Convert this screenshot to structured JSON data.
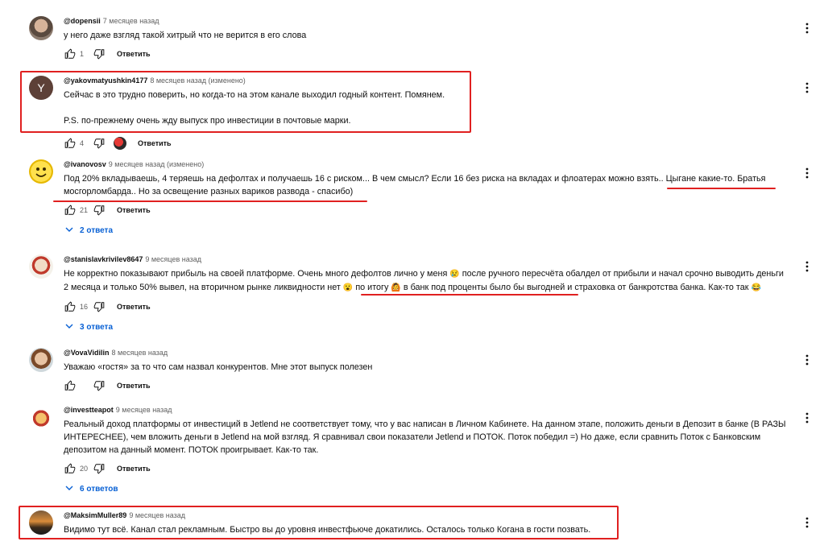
{
  "comments": [
    {
      "author": "@dopensii",
      "time": "7 месяцев назад",
      "text": [
        "у него даже взгляд такой хитрый что не верится в его слова"
      ],
      "likes": "1",
      "reply_label": "Ответить",
      "avatar": "photo"
    },
    {
      "author": "@yakovmatyushkin4177",
      "time": "8 месяцев назад (изменено)",
      "text": [
        "Сейчас в это трудно поверить, но когда-то на этом канале выходил годный контент. Помянем.",
        "P.S. по-прежнему очень жду выпуск про инвестиции в почтовые марки."
      ],
      "likes": "4",
      "reply_label": "Ответить",
      "avatar_letter": "Y"
    },
    {
      "author": "@ivanovosv",
      "time": "9 месяцев назад (изменено)",
      "text_line1": "Под 20% вкладываешь, 4 теряешь на дефолтах и получаешь 16 с риском... В чем смысл? Если 16 без риска на вкладах и флоатерах можно взять.. Цыгане какие-то. Братья",
      "text_line2": "мосгорломбарда.. Но за освещение разных вариков развода - спасибо)",
      "likes": "21",
      "reply_label": "Ответить",
      "replies": "2 ответа"
    },
    {
      "author": "@stanislavkrivilev8647",
      "time": "9 месяцев назад",
      "text_line1": "Не корректно показывают прибыль на своей платформе. Очень много дефолтов лично у меня",
      "text_line1b": "после ручного пересчёта обалдел от прибыли и начал срочно выводить деньги",
      "text_line2a": "2 месяца и только 50% вывел, на вторичном рынке ликвидности нет",
      "text_line2b": "по итогу",
      "text_line2c": "в банк под проценты было бы выгодней",
      "text_line2d": "и страховка от банкротства банка. Как-то так",
      "likes": "16",
      "reply_label": "Ответить",
      "replies": "3 ответа"
    },
    {
      "author": "@VovaVidilin",
      "time": "8 месяцев назад",
      "text": [
        "Уважаю «гостя» за то что сам назвал конкурентов. Мне этот выпуск полезен"
      ],
      "likes": "",
      "reply_label": "Ответить"
    },
    {
      "author": "@investteapot",
      "time": "9 месяцев назад",
      "text": [
        "Реальный доход платформы от инвестиций в Jetlend  не соответствует тому, что у вас написан в Личном Кабинете. На данном этапе, положить деньги в Депозит в банке (В РАЗЫ ИНТЕРЕСНЕЕ), чем вложить деньги в Jetlend на мой взгляд. Я сравнивал свои показатели Jetlend и ПОТОК. Поток победил =) Но даже, если сравнить Поток с Банковским депозитом на данный момент. ПОТОК проигрывает. Как-то так."
      ],
      "likes": "20",
      "reply_label": "Ответить",
      "replies": "6 ответов"
    },
    {
      "author": "@MaksimMuller89",
      "time": "9 месяцев назад",
      "text": [
        "Видимо тут всё. Канал стал рекламным. Быстро вы до уровня инвестфьюче докатились. Осталось только Когана в гости позвать."
      ]
    }
  ],
  "colors": {
    "highlight": "#e02020",
    "link": "#065fd4",
    "secondary": "#606060"
  },
  "icons": [
    "thumb-up-icon",
    "thumb-down-icon",
    "chevron-down-icon",
    "more-vert-icon"
  ]
}
